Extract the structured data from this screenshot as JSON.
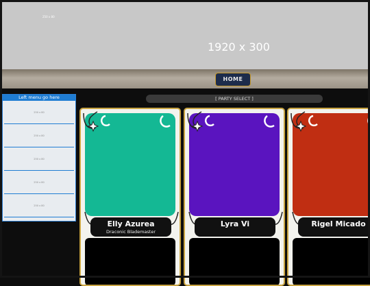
{
  "header": {
    "banner_small_label": "250 x 80",
    "banner_size_label": "1920 x 300",
    "home_button_label": "HOME"
  },
  "left_menu": {
    "title": "Left menu go here",
    "items": [
      "250 x 80",
      "250 x 80",
      "250 x 80",
      "250 x 80",
      "250 x 80"
    ]
  },
  "party_select_label": "[ PARTY SELECT ]",
  "cards": [
    {
      "name": "Elly Azurea",
      "subtitle": "Draconic Blademaster",
      "color": "#14b894"
    },
    {
      "name": "Lyra Vi",
      "subtitle": "",
      "color": "#5a14bf"
    },
    {
      "name": "Rigel Micado",
      "subtitle": "",
      "color": "#c02e12"
    }
  ],
  "colors": {
    "accent_blue": "#1f7dd3",
    "card_border_gold": "#c9a441",
    "home_button_bg": "#1d2c4b"
  }
}
